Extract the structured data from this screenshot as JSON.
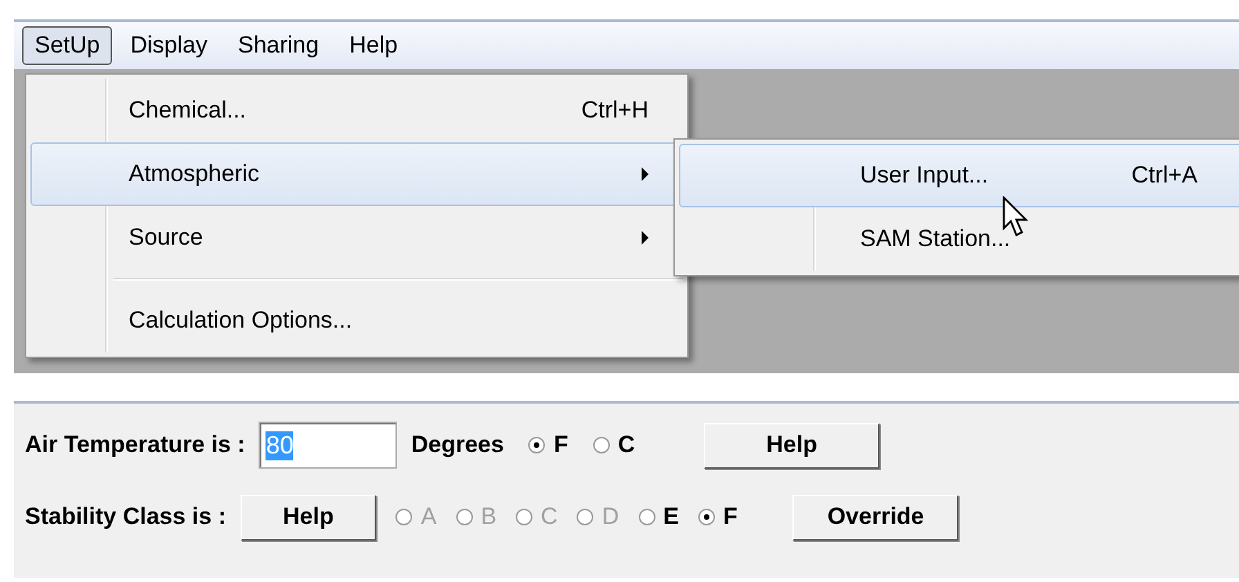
{
  "menu_bar": [
    {
      "label": "SetUp",
      "selected": true
    },
    {
      "label": "Display",
      "selected": false
    },
    {
      "label": "Sharing",
      "selected": false
    },
    {
      "label": "Help",
      "selected": false
    }
  ],
  "menu": {
    "items": [
      {
        "kind": "item",
        "label": "Chemical...",
        "shortcut": "Ctrl+H",
        "has_submenu": false,
        "highlighted": false
      },
      {
        "kind": "item",
        "label": "Atmospheric",
        "has_submenu": true,
        "highlighted": true
      },
      {
        "kind": "item",
        "label": "Source",
        "has_submenu": true,
        "highlighted": false
      },
      {
        "kind": "separator"
      },
      {
        "kind": "item",
        "label": "Calculation Options...",
        "has_submenu": false,
        "highlighted": false
      }
    ]
  },
  "submenu": {
    "items": [
      {
        "kind": "item",
        "label": "User Input...",
        "shortcut": "Ctrl+A",
        "has_submenu": false,
        "highlighted": true
      },
      {
        "kind": "item",
        "label": "SAM Station...",
        "has_submenu": false,
        "highlighted": false
      }
    ]
  },
  "air_temperature": {
    "label": "Air Temperature is :",
    "value": "80",
    "units_label": "Degrees",
    "units": [
      {
        "label": "F",
        "selected": true
      },
      {
        "label": "C",
        "selected": false
      }
    ],
    "help": "Help"
  },
  "stability": {
    "label": "Stability Class is :",
    "help": "Help",
    "classes": [
      {
        "label": "A",
        "selected": false,
        "disabled": true
      },
      {
        "label": "B",
        "selected": false,
        "disabled": true
      },
      {
        "label": "C",
        "selected": false,
        "disabled": true
      },
      {
        "label": "D",
        "selected": false,
        "disabled": true
      },
      {
        "label": "E",
        "selected": false,
        "disabled": false
      },
      {
        "label": "F",
        "selected": true,
        "disabled": false
      }
    ],
    "override": "Override"
  }
}
